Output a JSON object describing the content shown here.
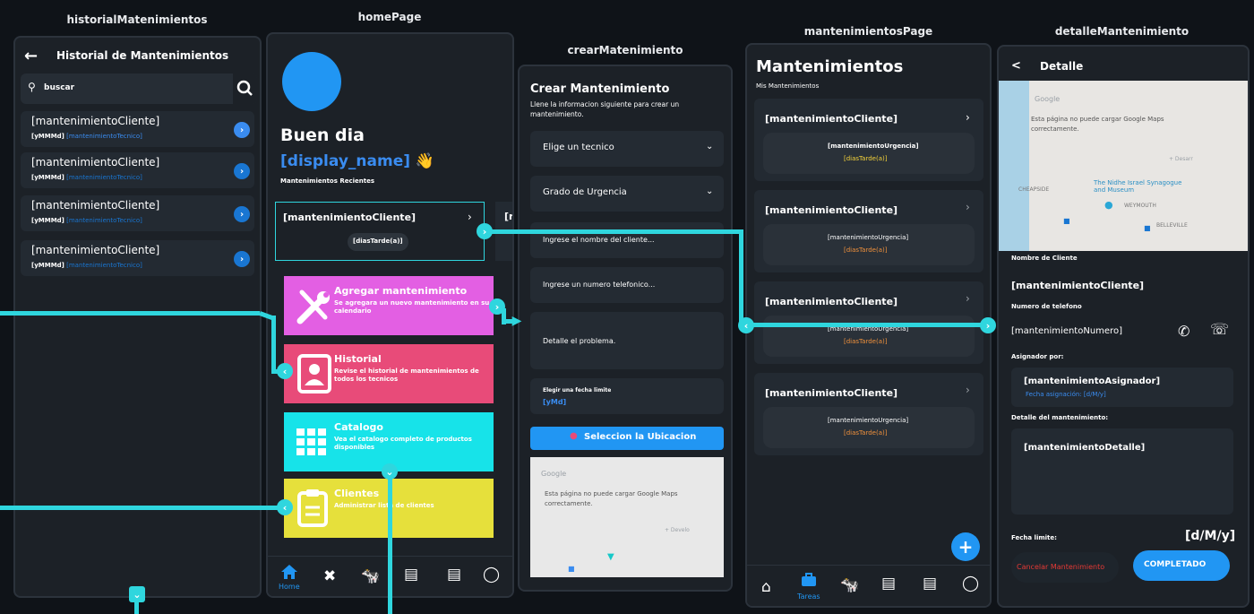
{
  "frames": {
    "historial": "historialMatenimientos",
    "home": "homePage",
    "crear": "crearMatenimiento",
    "mantenimientos": "mantenimientosPage",
    "detalle": "detalleMantenimiento"
  },
  "historial": {
    "back": "←",
    "title": "Historial de Mantenimientos",
    "search_placeholder": "buscar",
    "items": [
      {
        "client": "[mantenimientoCliente]",
        "date": "[yMMMd]",
        "tech": "[mantenimientoTecnico]"
      },
      {
        "client": "[mantenimientoCliente]",
        "date": "[yMMMd]",
        "tech": "[mantenimientoTecnico]"
      },
      {
        "client": "[mantenimientoCliente]",
        "date": "[yMMMd]",
        "tech": "[mantenimientoTecnico]"
      },
      {
        "client": "[mantenimientoCliente]",
        "date": "[yMMMd]",
        "tech": "[mantenimientoTecnico]"
      }
    ]
  },
  "home": {
    "greeting": "Buen dia",
    "display_name": "[display_name]",
    "wave": "👋",
    "recent_label": "Mantenimientos Recientes",
    "card": {
      "client": "[mantenimientoCliente]",
      "days": "[diasTarde(a)]",
      "peek": "[r"
    },
    "tiles": [
      {
        "title": "Agregar mantenimiento",
        "desc": "Se agregara un nuevo mantenimiento en su calendario",
        "color": "#e35fe3"
      },
      {
        "title": "Historial",
        "desc": "Revise el historial de mantenimientos de todos los tecnicos",
        "color": "#e84b79"
      },
      {
        "title": "Catalogo",
        "desc": "Vea el catalogo completo de productos disponibles",
        "color": "#17e3e9"
      },
      {
        "title": "Clientes",
        "desc": "Administrar lista de clientes",
        "color": "#e6e03b"
      }
    ],
    "nav": {
      "home_label": "Home"
    }
  },
  "crear": {
    "title": "Crear Mantenimiento",
    "subtitle": "Llene la informacion siguiente para crear un mantenimiento.",
    "tecnico": "Elige un tecnico",
    "urgencia": "Grado de Urgencia",
    "cliente_placeholder": "Ingrese el nombre del cliente...",
    "telefono_placeholder": "Ingrese un numero telefonico...",
    "detalle_placeholder": "Detalle el problema.",
    "fecha_label": "Elegir una fecha limite",
    "fecha_value": "[yMd]",
    "ubicacion_button": "Seleccion la Ubicacion",
    "map_google": "Google",
    "map_error": "Esta página no puede cargar Google Maps correctamente.",
    "map_dev": "+ Develo"
  },
  "mantenimientos": {
    "title": "Mantenimientos",
    "subtitle": "Mis Mantenimientos",
    "cards": [
      {
        "client": "[mantenimientoCliente]",
        "urgencia": "[mantenimientoUrgencia]",
        "dias": "[diasTarde(a)]",
        "dias_color": "#f5d33a"
      },
      {
        "client": "[mantenimientoCliente]",
        "urgencia": "[mantenimientoUrgencia]",
        "dias": "[diasTarde(a)]",
        "dias_color": "#f0913c"
      },
      {
        "client": "[mantenimientoCliente]",
        "urgencia": "[mantenimientoUrgencia]",
        "dias": "[diasTarde(a)]",
        "dias_color": "#f0913c"
      },
      {
        "client": "[mantenimientoCliente]",
        "urgencia": "[mantenimientoUrgencia]",
        "dias": "[diasTarde(a)]",
        "dias_color": "#f0913c"
      }
    ],
    "fab": "+",
    "nav": {
      "tareas_label": "Tareas"
    }
  },
  "detalle": {
    "back": "<",
    "title": "Detalle",
    "map": {
      "google": "Google",
      "error": "Esta página no puede cargar Google Maps correctamente.",
      "dev": "+ Desarr",
      "place1": "The Nidhe Israel Synagogue and Museum",
      "place2": "CHEAPSIDE",
      "place3": "BELLEVILLE",
      "place4": "WEYMOUTH"
    },
    "cliente_label": "Nombre de Cliente",
    "cliente_value": "[mantenimientoCliente]",
    "telefono_label": "Numero de telefono",
    "telefono_value": "[mantenimientoNumero]",
    "asignador_label": "Asignador por:",
    "asignador_value": "[mantenimientoAsignador]",
    "asignacion_fecha": "Fecha asignación: [d/M/y]",
    "detalle_label": "Detalle del mantenimiento:",
    "detalle_value": "[mantenimientoDetalle]",
    "fecha_limite_label": "Fecha limite:",
    "fecha_limite_value": "[d/M/y]",
    "cancel_button": "Cancelar Mantenimiento",
    "complete_button": "COMPLETADO"
  },
  "colors": {
    "accent": "#2fd6de",
    "link_blue": "#3a8cf0",
    "primary_button": "#2196f3",
    "cancel_text": "#e53935"
  }
}
